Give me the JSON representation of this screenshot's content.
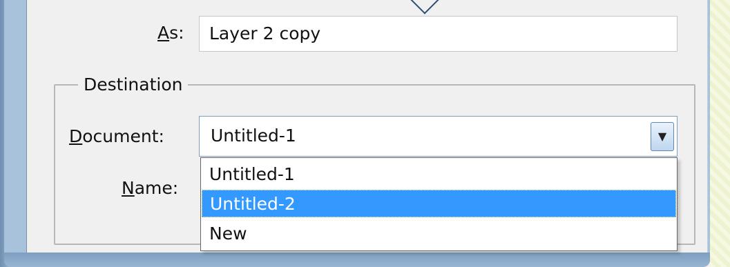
{
  "as_label": "As:",
  "as_underline": "A",
  "as_rest": "s:",
  "as_value": "Layer 2 copy",
  "destination": {
    "title": "Destination",
    "document_label_underline": "D",
    "document_label_rest": "ocument:",
    "name_label_underline": "N",
    "name_label_rest": "ame:"
  },
  "document_combo": {
    "selected_value": "Untitled-1",
    "options": [
      "Untitled-1",
      "Untitled-2",
      "New"
    ],
    "highlighted": "Untitled-2"
  },
  "colors": {
    "highlight": "#3399ff",
    "dialog_bg": "#f0f0f0"
  }
}
